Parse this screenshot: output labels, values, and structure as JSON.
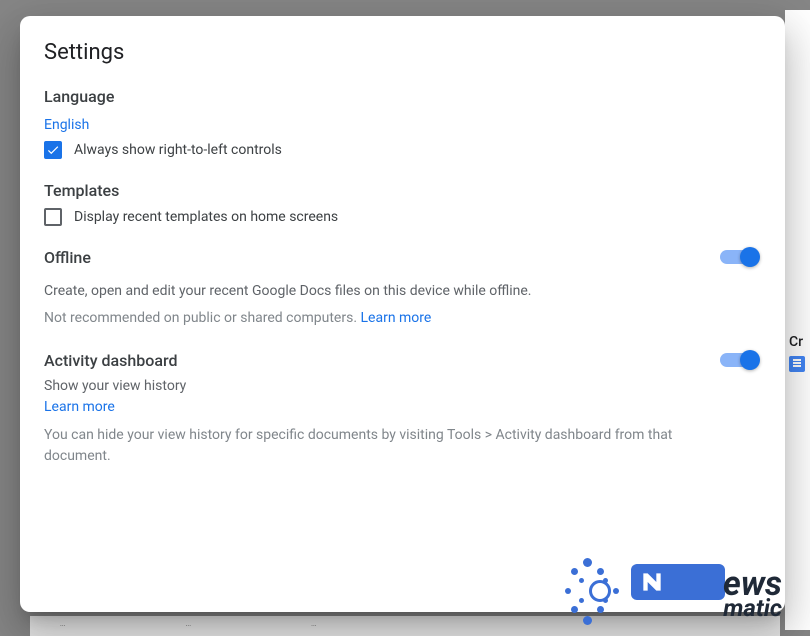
{
  "dialog": {
    "title": "Settings",
    "language": {
      "heading": "Language",
      "link": "English",
      "checkbox_checked": true,
      "checkbox_label": "Always show right-to-left controls"
    },
    "templates": {
      "heading": "Templates",
      "checkbox_checked": false,
      "checkbox_label": "Display recent templates on home screens"
    },
    "offline": {
      "heading": "Offline",
      "toggle_on": true,
      "desc": "Create, open and edit your recent Google Docs files on this device while offline.",
      "warning": "Not recommended on public or shared computers.",
      "learn_more": "Learn more"
    },
    "activity": {
      "heading": "Activity dashboard",
      "subtext": "Show your view history",
      "toggle_on": true,
      "learn_more": "Learn more",
      "footnote": "You can hide your view history for specific documents by visiting Tools > Activity dashboard from that document."
    }
  },
  "background": {
    "sidebar_text": "Cr"
  },
  "logo": {
    "text_news": "ews",
    "text_matic": "matic"
  }
}
